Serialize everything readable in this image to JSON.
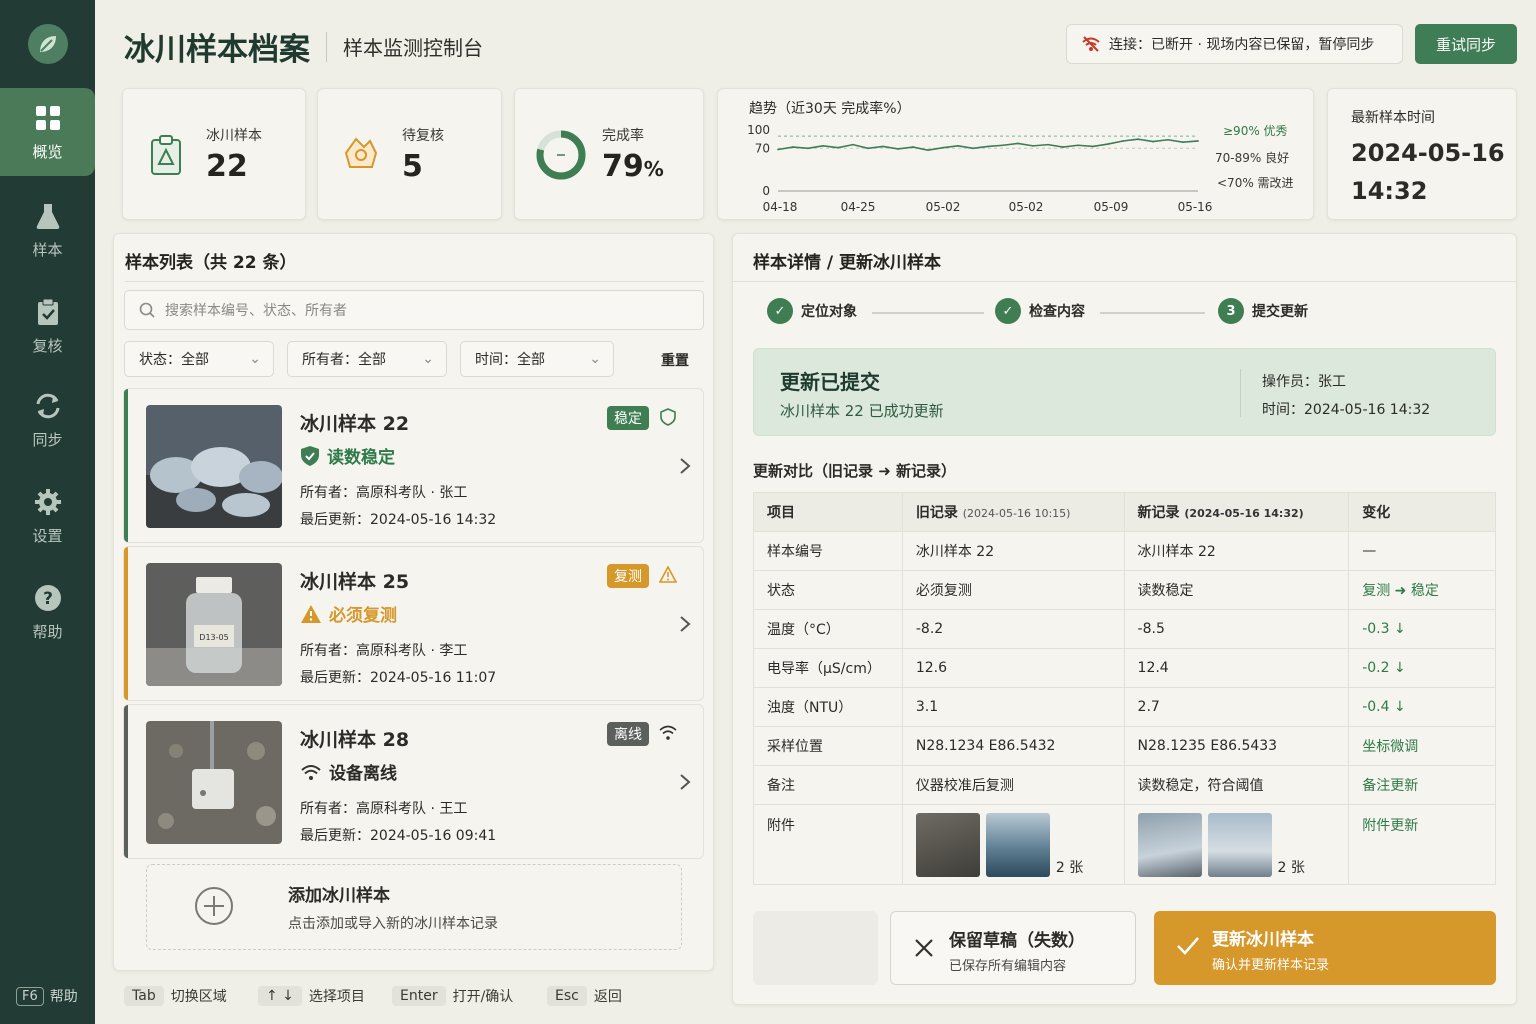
{
  "sidebar": {
    "items": [
      {
        "label": "概览",
        "icon": "grid-icon",
        "active": true
      },
      {
        "label": "样本",
        "icon": "flask-icon"
      },
      {
        "label": "复核",
        "icon": "clipboard-check-icon"
      },
      {
        "label": "同步",
        "icon": "sync-icon"
      },
      {
        "label": "设置",
        "icon": "gear-icon"
      },
      {
        "label": "帮助",
        "icon": "help-icon"
      }
    ],
    "help_key": "F6",
    "help_label": "帮助"
  },
  "header": {
    "title": "冰川样本档案",
    "subtitle": "样本监测控制台",
    "connection_text": "连接：已断开 · 现场内容已保留，暂停同步",
    "retry_label": "重试同步"
  },
  "stats": {
    "samples": {
      "label": "冰川样本",
      "value": "22"
    },
    "pending": {
      "label": "待复核",
      "value": "5"
    },
    "completion": {
      "label": "完成率",
      "value": "79",
      "unit": "%",
      "fraction": 0.79
    }
  },
  "trend": {
    "title": "趋势（近30天 完成率%）",
    "y_ticks": [
      "100",
      "70",
      "0"
    ],
    "x_ticks": [
      "04-18",
      "04-25",
      "05-02",
      "05-02",
      "05-09",
      "05-16"
    ],
    "legend": [
      "≥90% 优秀",
      "70-89% 良好",
      "<70% 需改进"
    ]
  },
  "chart_data": {
    "type": "line",
    "title": "趋势（近30天 完成率%）",
    "x": [
      "04-18",
      "04-19",
      "04-20",
      "04-21",
      "04-22",
      "04-23",
      "04-24",
      "04-25",
      "04-26",
      "04-27",
      "04-28",
      "04-29",
      "04-30",
      "05-01",
      "05-02",
      "05-03",
      "05-04",
      "05-05",
      "05-06",
      "05-07",
      "05-08",
      "05-09",
      "05-10",
      "05-11",
      "05-12",
      "05-13",
      "05-14",
      "05-15",
      "05-16"
    ],
    "series": [
      {
        "values": [
          68,
          72,
          70,
          74,
          71,
          76,
          70,
          73,
          69,
          72,
          67,
          71,
          74,
          70,
          73,
          75,
          78,
          74,
          76,
          72,
          75,
          73,
          77,
          82,
          85,
          81,
          84,
          80,
          82
        ]
      }
    ],
    "ylim": [
      0,
      100
    ],
    "y_ticks": [
      0,
      70,
      100
    ],
    "reference_lines": [
      90,
      70
    ],
    "grid": false,
    "legend_position": "right"
  },
  "latest": {
    "label": "最新样本时间",
    "date": "2024-05-16",
    "time": "14:32"
  },
  "list": {
    "title": "样本列表（共 22 条）",
    "search_placeholder": "搜索样本编号、状态、所有者",
    "filters": {
      "status": "状态：全部",
      "owner": "所有者：全部",
      "time": "时间：全部",
      "reset": "重置"
    },
    "samples": [
      {
        "name": "冰川样本 22",
        "status": "读数稳定",
        "badge": "稳定",
        "owner": "所有者：高原科考队 · 张工",
        "updated": "最后更新：2024-05-16 14:32",
        "color": "#3f7d53"
      },
      {
        "name": "冰川样本 25",
        "status": "必须复测",
        "badge": "复测",
        "owner": "所有者：高原科考队 · 李工",
        "updated": "最后更新：2024-05-16 11:07",
        "color": "#d6982a",
        "bottle_label": "D13-05"
      },
      {
        "name": "冰川样本 28",
        "status": "设备离线",
        "badge": "离线",
        "owner": "所有者：高原科考队 · 王工",
        "updated": "最后更新：2024-05-16 09:41",
        "color": "#5b605c"
      }
    ],
    "add": {
      "title": "添加冰川样本",
      "desc": "点击添加或导入新的冰川样本记录"
    }
  },
  "detail": {
    "title": "样本详情 / 更新冰川样本",
    "steps": [
      "定位对象",
      "检查内容",
      "提交更新"
    ],
    "step3_num": "3",
    "success": {
      "title": "更新已提交",
      "desc": "冰川样本 22 已成功更新",
      "operator": "操作员：张工",
      "time": "时间：2024-05-16 14:32"
    },
    "compare_title": "更新对比（旧记录 ➜ 新记录）",
    "headers": {
      "item": "项目",
      "old": "旧记录",
      "old_time": "(2024-05-16 10:15)",
      "new": "新记录",
      "new_time": "(2024-05-16 14:32)",
      "change": "变化"
    },
    "rows": [
      {
        "item": "样本编号",
        "old": "冰川样本 22",
        "new": "冰川样本 22",
        "change": "—"
      },
      {
        "item": "状态",
        "old": "必须复测",
        "new": "读数稳定",
        "change": "复测 ➜ 稳定"
      },
      {
        "item": "温度（°C）",
        "old": "-8.2",
        "new": "-8.5",
        "change": "-0.3 ↓"
      },
      {
        "item": "电导率（μS/cm）",
        "old": "12.6",
        "new": "12.4",
        "change": "-0.2 ↓"
      },
      {
        "item": "浊度（NTU）",
        "old": "3.1",
        "new": "2.7",
        "change": "-0.4 ↓"
      },
      {
        "item": "采样位置",
        "old": "N28.1234 E86.5432",
        "new": "N28.1235 E86.5433",
        "change": "坐标微调"
      },
      {
        "item": "备注",
        "old": "仪器校准后复测",
        "new": "读数稳定，符合阈值",
        "change": "备注更新"
      }
    ],
    "attachments": {
      "item": "附件",
      "old_count": "2 张",
      "new_count": "2 张",
      "change": "附件更新"
    },
    "draft": {
      "title": "保留草稿（失数）",
      "desc": "已保存所有编辑内容"
    },
    "update": {
      "title": "更新冰川样本",
      "desc": "确认并更新样本记录"
    }
  },
  "hints": [
    {
      "key": "Tab",
      "label": "切换区域"
    },
    {
      "key": "↑ ↓",
      "label": "选择项目"
    },
    {
      "key": "Enter",
      "label": "打开/确认"
    },
    {
      "key": "Esc",
      "label": "返回"
    }
  ]
}
